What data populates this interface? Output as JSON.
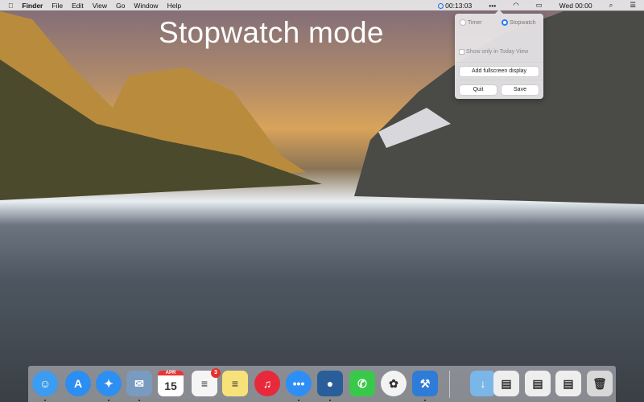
{
  "menubar": {
    "apple": "",
    "app": "Finder",
    "items": [
      "File",
      "Edit",
      "View",
      "Go",
      "Window",
      "Help"
    ],
    "timer": "00:13:03",
    "more": "•••",
    "clock": "Wed 00:00"
  },
  "overlay_title": "Stopwatch mode",
  "popover": {
    "timer": "Timer",
    "stopwatch": "Stopwatch",
    "mode": "stopwatch",
    "show_today": "Show only in Today View",
    "show_today_checked": false,
    "add_fullscreen": "Add fullscreen display",
    "quit": "Quit",
    "save": "Save"
  },
  "dock": {
    "apps": [
      {
        "name": "Finder",
        "glyph": "☺",
        "color": "#3b9cf0",
        "running": true
      },
      {
        "name": "App Store",
        "glyph": "A",
        "color": "#2b8ef0",
        "running": false
      },
      {
        "name": "Safari",
        "glyph": "✦",
        "color": "#2e8ff2",
        "running": true
      },
      {
        "name": "Mail",
        "glyph": "✉",
        "color": "#7a9bc0",
        "running": true
      },
      {
        "name": "Calendar",
        "glyph": "15",
        "color": "#ffffff",
        "running": false,
        "sub": "APR"
      },
      {
        "name": "Reminders",
        "glyph": "≡",
        "color": "#f5f5f5",
        "running": false,
        "badge": "3"
      },
      {
        "name": "Notes",
        "glyph": "≡",
        "color": "#f7e27a",
        "running": false
      },
      {
        "name": "iTunes",
        "glyph": "♫",
        "color": "#e62a3c",
        "running": false
      },
      {
        "name": "Messages",
        "glyph": "•••",
        "color": "#2d8ef5",
        "running": true
      },
      {
        "name": "Tweetbot",
        "glyph": "●",
        "color": "#2a5e9a",
        "running": true
      },
      {
        "name": "FaceTime",
        "glyph": "✆",
        "color": "#39c94a",
        "running": false
      },
      {
        "name": "Photos",
        "glyph": "✿",
        "color": "#f3f3f3",
        "running": false
      },
      {
        "name": "Xcode",
        "glyph": "⚒",
        "color": "#2f7bd8",
        "running": true
      }
    ],
    "stacks": [
      {
        "name": "Downloads",
        "glyph": "↓",
        "color": "#7bb6e8"
      },
      {
        "name": "Screenshot",
        "glyph": "▤",
        "color": "#eeeeee"
      },
      {
        "name": "Screenshot 2",
        "glyph": "▤",
        "color": "#eeeeee"
      },
      {
        "name": "Screenshot 3",
        "glyph": "▤",
        "color": "#eeeeee"
      },
      {
        "name": "Trash",
        "glyph": "🗑",
        "color": "#d8d8d8"
      }
    ]
  }
}
